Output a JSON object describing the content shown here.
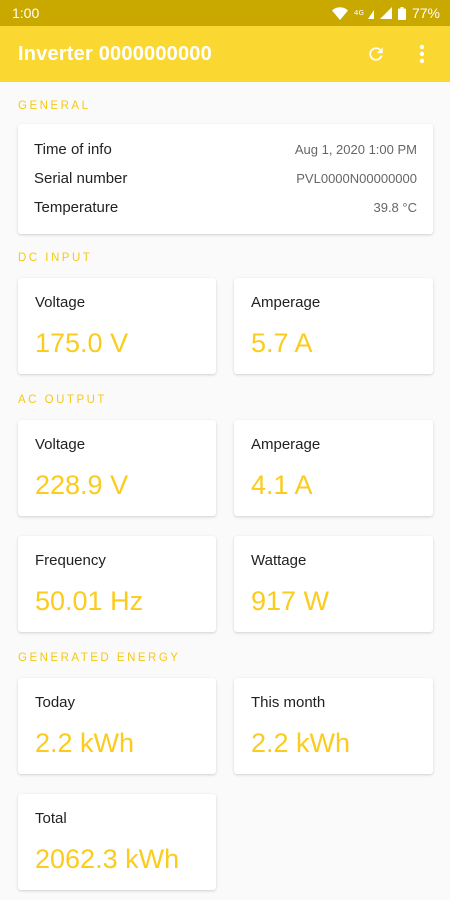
{
  "status_bar": {
    "time": "1:00",
    "battery": "77%"
  },
  "app_bar": {
    "title": "Inverter 0000000000",
    "refresh_icon": "refresh-icon",
    "menu_icon": "more-vert-icon"
  },
  "colors": {
    "status_bar": "#c9a800",
    "app_bar": "#fbd831",
    "accent": "#fbcb1e"
  },
  "general": {
    "title": "GENERAL",
    "rows": [
      {
        "label": "Time of info",
        "value": "Aug 1, 2020 1:00 PM"
      },
      {
        "label": "Serial number",
        "value": "PVL0000N00000000"
      },
      {
        "label": "Temperature",
        "value": "39.8 °C"
      }
    ]
  },
  "dc_input": {
    "title": "DC INPUT",
    "voltage": {
      "label": "Voltage",
      "value": "175.0 V"
    },
    "amperage": {
      "label": "Amperage",
      "value": "5.7 A"
    }
  },
  "ac_output": {
    "title": "AC OUTPUT",
    "voltage": {
      "label": "Voltage",
      "value": "228.9 V"
    },
    "amperage": {
      "label": "Amperage",
      "value": "4.1 A"
    },
    "frequency": {
      "label": "Frequency",
      "value": "50.01 Hz"
    },
    "wattage": {
      "label": "Wattage",
      "value": "917 W"
    }
  },
  "generated_energy": {
    "title": "GENERATED ENERGY",
    "today": {
      "label": "Today",
      "value": "2.2 kWh"
    },
    "this_month": {
      "label": "This month",
      "value": "2.2 kWh"
    },
    "total": {
      "label": "Total",
      "value": "2062.3 kWh"
    }
  }
}
